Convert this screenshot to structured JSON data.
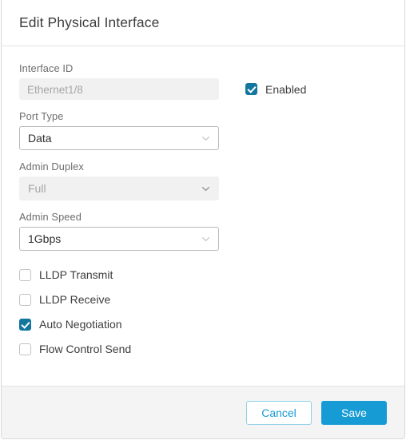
{
  "dialog": {
    "title": "Edit Physical Interface"
  },
  "form": {
    "interface_id": {
      "label": "Interface ID",
      "value": "Ethernet1/8",
      "placeholder": "Ethernet1/8",
      "disabled_state": "disabled"
    },
    "enabled_checkbox": {
      "label": "Enabled",
      "checked": "true"
    },
    "port_type": {
      "label": "Port Type",
      "value": "Data",
      "icon": "chevron-down-icon",
      "disabled_state": "enabled"
    },
    "admin_duplex": {
      "label": "Admin Duplex",
      "value": "Full",
      "icon": "chevron-down-icon",
      "disabled_state": "disabled"
    },
    "admin_speed": {
      "label": "Admin Speed",
      "value": "1Gbps",
      "icon": "chevron-down-icon",
      "disabled_state": "enabled"
    },
    "checkboxes": [
      {
        "label": "LLDP Transmit",
        "checked": "false"
      },
      {
        "label": "LLDP Receive",
        "checked": "false"
      },
      {
        "label": "Auto Negotiation",
        "checked": "true"
      },
      {
        "label": "Flow Control Send",
        "checked": "false"
      }
    ]
  },
  "footer": {
    "cancel_label": "Cancel",
    "save_label": "Save"
  },
  "colors": {
    "accent_blue": "#169bd5",
    "checkbox_blue": "#12769f",
    "label_gray": "#6d6d6d",
    "disabled_bg": "#f1f1f1",
    "footer_bg": "#f4f4f4"
  }
}
